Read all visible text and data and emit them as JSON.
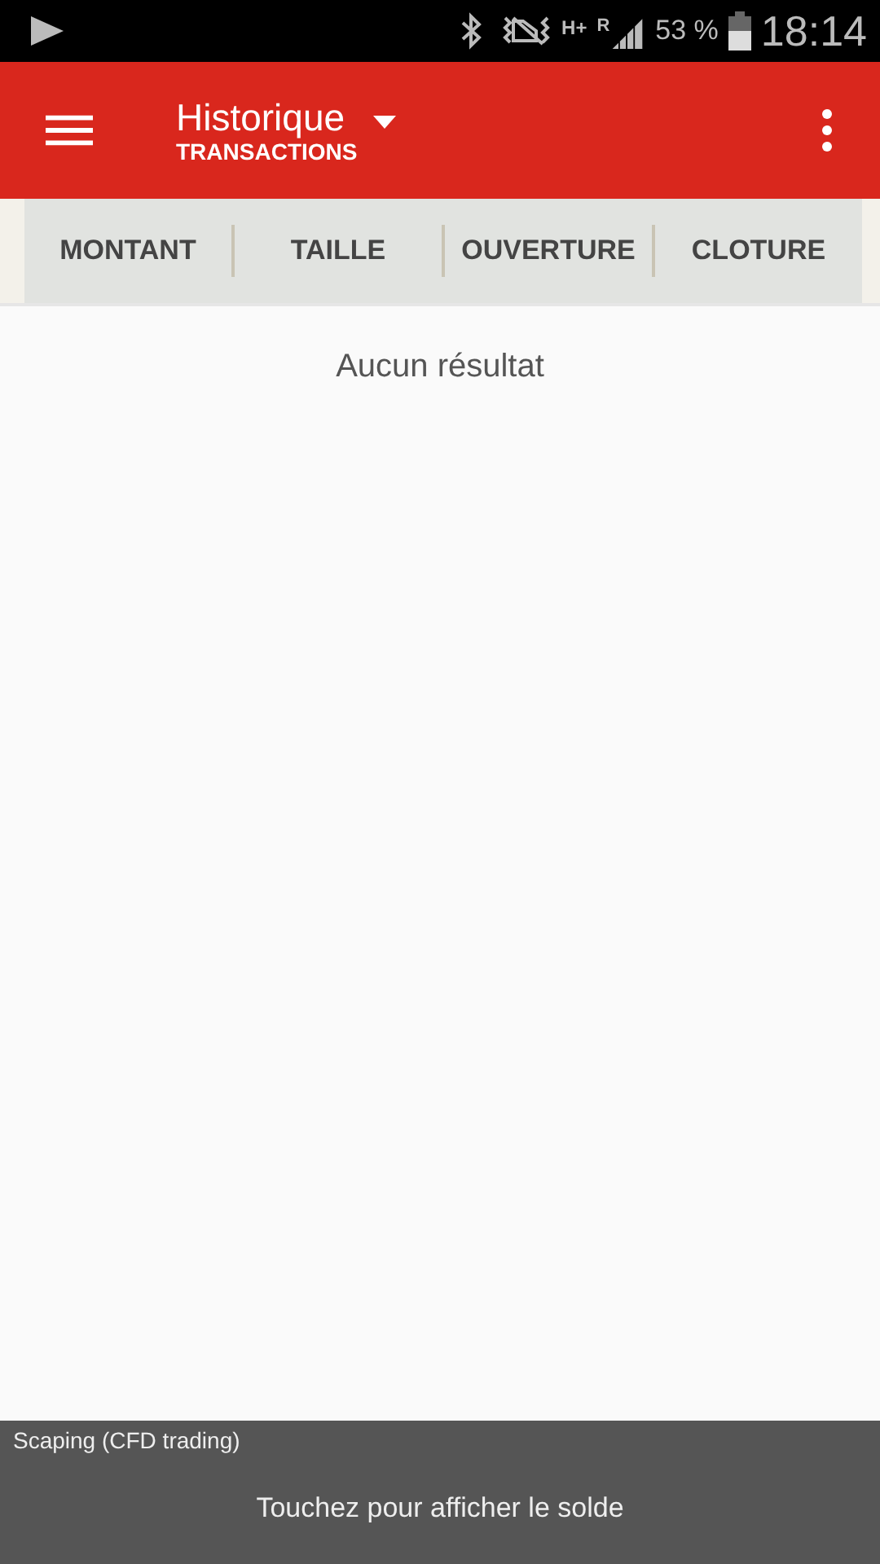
{
  "status_bar": {
    "network_type": "H+",
    "roaming": "R",
    "battery": "53 %",
    "time": "18:14"
  },
  "toolbar": {
    "title": "Historique",
    "subtitle": "TRANSACTIONS"
  },
  "columns": [
    "MONTANT",
    "TAILLE",
    "OUVERTURE",
    "CLOTURE"
  ],
  "empty_message": "Aucun résultat",
  "footer": {
    "account": "Scaping (CFD trading)",
    "action": "Touchez pour afficher le solde"
  }
}
